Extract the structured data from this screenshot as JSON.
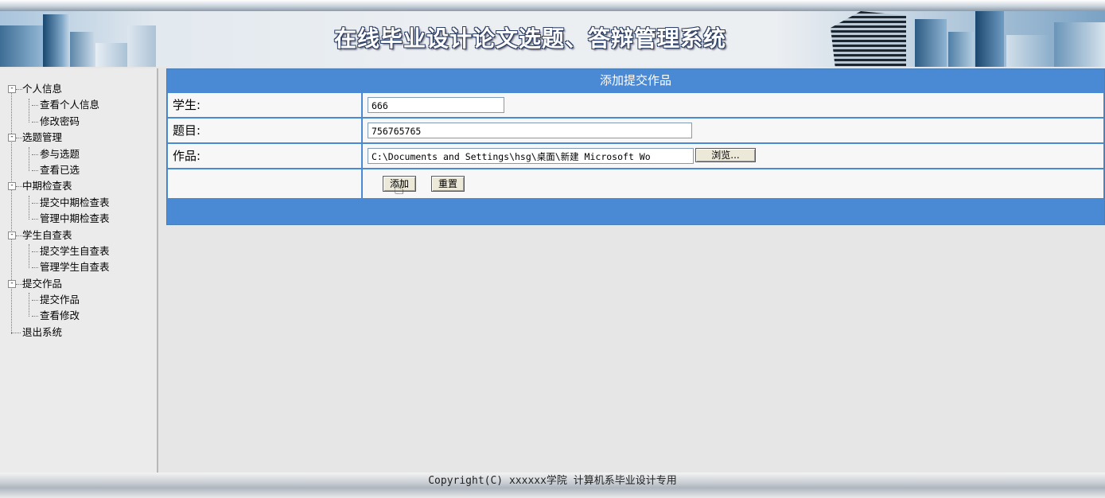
{
  "header": {
    "title": "在线毕业设计论文选题、答辩管理系统"
  },
  "sidebar": {
    "groups": [
      {
        "label": "个人信息",
        "items": [
          "查看个人信息",
          "修改密码"
        ]
      },
      {
        "label": "选题管理",
        "items": [
          "参与选题",
          "查看已选"
        ]
      },
      {
        "label": "中期检查表",
        "items": [
          "提交中期检查表",
          "管理中期检查表"
        ]
      },
      {
        "label": "学生自查表",
        "items": [
          "提交学生自查表",
          "管理学生自查表"
        ]
      },
      {
        "label": "提交作品",
        "items": [
          "提交作品",
          "查看修改"
        ]
      }
    ],
    "logout": "退出系统",
    "expand_glyph": "-"
  },
  "form": {
    "title": "添加提交作品",
    "student_label": "学生:",
    "student_value": "666",
    "topic_label": "题目:",
    "topic_value": "756765765",
    "work_label": "作品:",
    "work_value": "C:\\Documents and Settings\\hsg\\桌面\\新建 Microsoft Wo",
    "browse_label": "浏览...",
    "add_label": "添加",
    "reset_label": "重置"
  },
  "footer": {
    "copyright": "Copyright(C) xxxxxx学院 计算机系毕业设计专用"
  },
  "colors": {
    "accent": "#4a8ad4",
    "row_bg": "#f7f7f7",
    "page_bg": "#e6e6e6"
  }
}
